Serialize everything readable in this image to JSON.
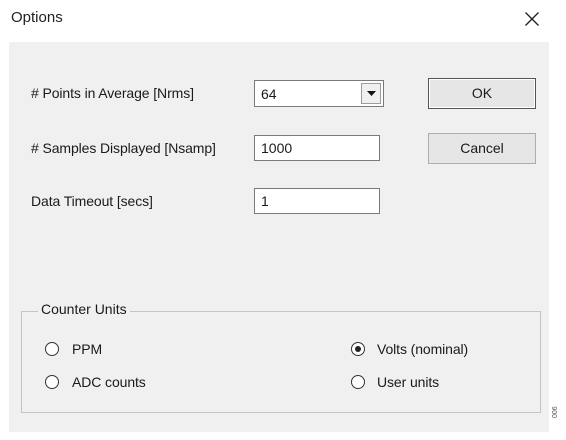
{
  "window": {
    "title": "Options"
  },
  "fields": {
    "points_label": "# Points in Average [Nrms]",
    "points_value": "64",
    "samples_label": "# Samples Displayed [Nsamp]",
    "samples_value": "1000",
    "timeout_label": "Data Timeout [secs]",
    "timeout_value": "1"
  },
  "buttons": {
    "ok": "OK",
    "cancel": "Cancel"
  },
  "counter_units": {
    "title": "Counter Units",
    "options": [
      {
        "label": "PPM",
        "checked": false
      },
      {
        "label": "ADC counts",
        "checked": false
      },
      {
        "label": "Volts (nominal)",
        "checked": true
      },
      {
        "label": "User units",
        "checked": false
      }
    ]
  },
  "figure_mark": "006"
}
